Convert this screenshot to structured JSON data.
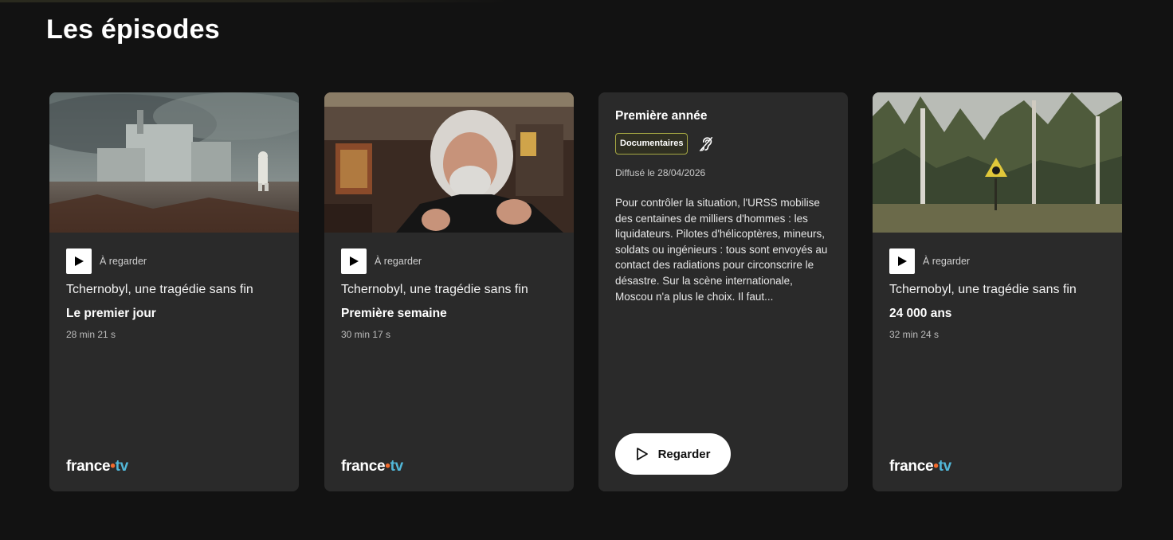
{
  "section": {
    "title": "Les épisodes"
  },
  "logo": {
    "left": "france",
    "dot": "•",
    "right": "tv"
  },
  "cards": [
    {
      "watch_label": "À regarder",
      "series": "Tchernobyl, une tragédie sans fin",
      "episode": "Le premier jour",
      "duration": "28 min 21 s",
      "thumb": "power-plant-ruins-with-hazmat-figure"
    },
    {
      "watch_label": "À regarder",
      "series": "Tchernobyl, une tragédie sans fin",
      "episode": "Première semaine",
      "duration": "30 min 17 s",
      "thumb": "interview-grey-haired-man"
    },
    {
      "title": "Première année",
      "badge": "Documentaires",
      "icon": "hearing-impaired-icon",
      "aired": "Diffusé le 28/04/2026",
      "synopsis": "Pour contrôler la situation, l'URSS mobilise des centaines de milliers d'hommes : les liquidateurs. Pilotes d'hélicoptères, mineurs, soldats ou ingénieurs : tous sont envoyés au contact des radiations pour circonscrire le désastre. Sur la scène internationale, Moscou n'a plus le choix. Il faut...",
      "button_label": "Regarder"
    },
    {
      "watch_label": "À regarder",
      "series": "Tchernobyl, une tragédie sans fin",
      "episode": "24 000 ans",
      "duration": "32 min 24 s",
      "thumb": "forest-with-radiation-sign"
    }
  ],
  "colors": {
    "background": "#121212",
    "card": "#2a2a2a",
    "badge_border": "#a6a843",
    "logo_dot": "#f06a2c",
    "logo_tv": "#52b7d8"
  }
}
